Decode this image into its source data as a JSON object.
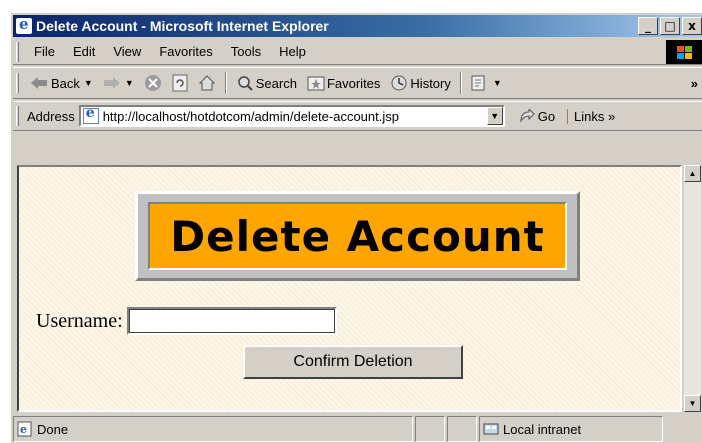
{
  "window": {
    "title": "Delete Account - Microsoft Internet Explorer",
    "caption_buttons": {
      "minimize": "_",
      "maximize": "□",
      "close": "x"
    }
  },
  "menu": {
    "items": [
      "File",
      "Edit",
      "View",
      "Favorites",
      "Tools",
      "Help"
    ]
  },
  "toolbar": {
    "back_label": "Back",
    "search_label": "Search",
    "favorites_label": "Favorites",
    "history_label": "History",
    "overflow": "»"
  },
  "address": {
    "label": "Address",
    "url": "http://localhost/hotdotcom/admin/delete-account.jsp",
    "go_label": "Go",
    "links_label": "Links »"
  },
  "page": {
    "banner_title": "Delete Account",
    "username_label": "Username:",
    "username_value": "",
    "submit_label": "Confirm Deletion"
  },
  "status": {
    "text": "Done",
    "zone": "Local intranet"
  },
  "colors": {
    "titlebar_start": "#0a246a",
    "titlebar_end": "#a6caf0",
    "banner_fill": "#ffa500",
    "page_bg": "#fdf5e6",
    "chrome": "#d4d0c8"
  },
  "icons": {
    "app": "ie-logo-icon",
    "back": "back-arrow-icon",
    "forward": "forward-arrow-icon",
    "stop": "stop-icon",
    "refresh": "refresh-icon",
    "home": "home-icon",
    "search": "search-icon",
    "favorites": "favorites-icon",
    "history": "history-icon",
    "edit": "edit-icon"
  }
}
